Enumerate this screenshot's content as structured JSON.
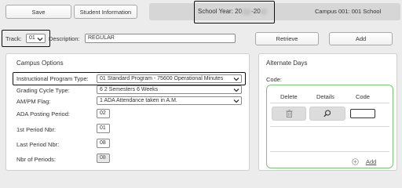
{
  "toolbar": {
    "save_label": "Save",
    "student_info_label": "Student Information"
  },
  "header": {
    "school_year_label": "School Year:",
    "school_year_start": "20",
    "school_year_end": "-20",
    "campus_label": "Campus 001: 001 School"
  },
  "track": {
    "label": "Track:",
    "value": "01",
    "description_label": "Description:",
    "description_value": "REGULAR",
    "retrieve_label": "Retrieve",
    "add_label": "Add"
  },
  "campus_options": {
    "title": "Campus Options",
    "fields": [
      {
        "label": "Instructional Program Type:",
        "value": "01 Standard Program - 75600 Operational Minutes"
      },
      {
        "label": "Grading Cycle Type:",
        "value": "6 2 Semesters 6 Weeks"
      },
      {
        "label": "AM/PM Flag:",
        "value": "1 ADA Attendance taken in A.M."
      },
      {
        "label": "ADA Posting Period:",
        "value": "02"
      },
      {
        "label": "1st Period Nbr:",
        "value": "01"
      },
      {
        "label": "Last Period Nbr:",
        "value": "08"
      },
      {
        "label": "Nbr of Periods:",
        "value": "08"
      }
    ]
  },
  "alternate_days": {
    "title": "Alternate Days",
    "code_label": "Code:",
    "columns": [
      "Delete",
      "Details",
      "Code"
    ],
    "add_label": "Add"
  },
  "icons": [
    "trash-icon",
    "search-icon",
    "chevron-down-icon",
    "plus-circle-icon"
  ],
  "colors": {
    "accent_green": "#7cc07a",
    "callout_border": "#111111",
    "background": "#ececec"
  }
}
